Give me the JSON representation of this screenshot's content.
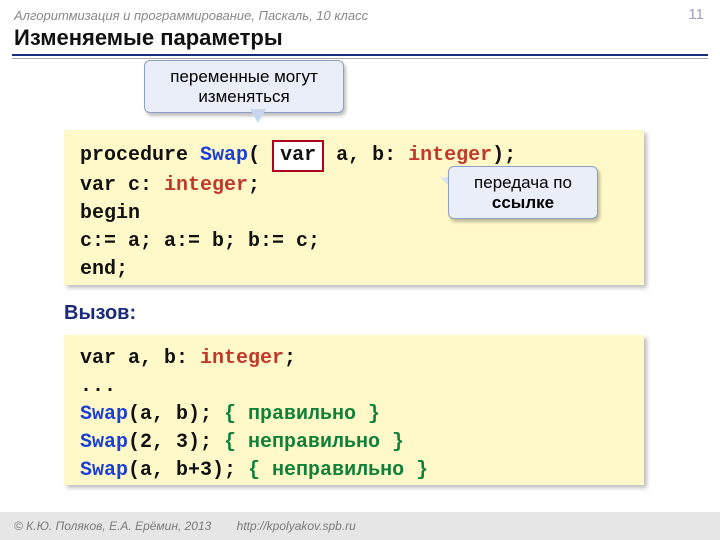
{
  "breadcrumb": "Алгоритмизация и программирование, Паскаль, 10 класс",
  "page_number": "11",
  "title": "Изменяемые параметры",
  "callout1_l1": "переменные могут",
  "callout1_l2": "изменяться",
  "callout2_l1": "передача по",
  "callout2_l2": "ссылке",
  "code1": {
    "procedure": "procedure",
    "swap": "Swap",
    "open": "(",
    "var_box": "var",
    "params": " a, b: ",
    "integer1": "integer",
    "close": ");",
    "l2_var": "var",
    "l2_rest": " c: ",
    "l2_integer": "integer",
    "l2_semi": ";",
    "begin": "begin",
    "body": "  c:= a; a:= b; b:= c;",
    "end": "end",
    "end_semi": ";"
  },
  "call_label": "Вызов:",
  "code2": {
    "l1_var": "var",
    "l1_ab": " a, b: ",
    "l1_int": "integer",
    "l1_semi": ";",
    "dots": "...",
    "l3_swap": "Swap",
    "l3_args": "(a, b);",
    "l3_comment": " { правильно }",
    "l4_swap": "Swap",
    "l4_args": "(2, 3);",
    "l4_comment": " { неправильно }",
    "l5_swap": "Swap",
    "l5_args": "(a, b+3);",
    "l5_comment": " { неправильно }"
  },
  "footer_copy": "© К.Ю. Поляков, Е.А. Ерёмин, 2013",
  "footer_url": "http://kpolyakov.spb.ru"
}
